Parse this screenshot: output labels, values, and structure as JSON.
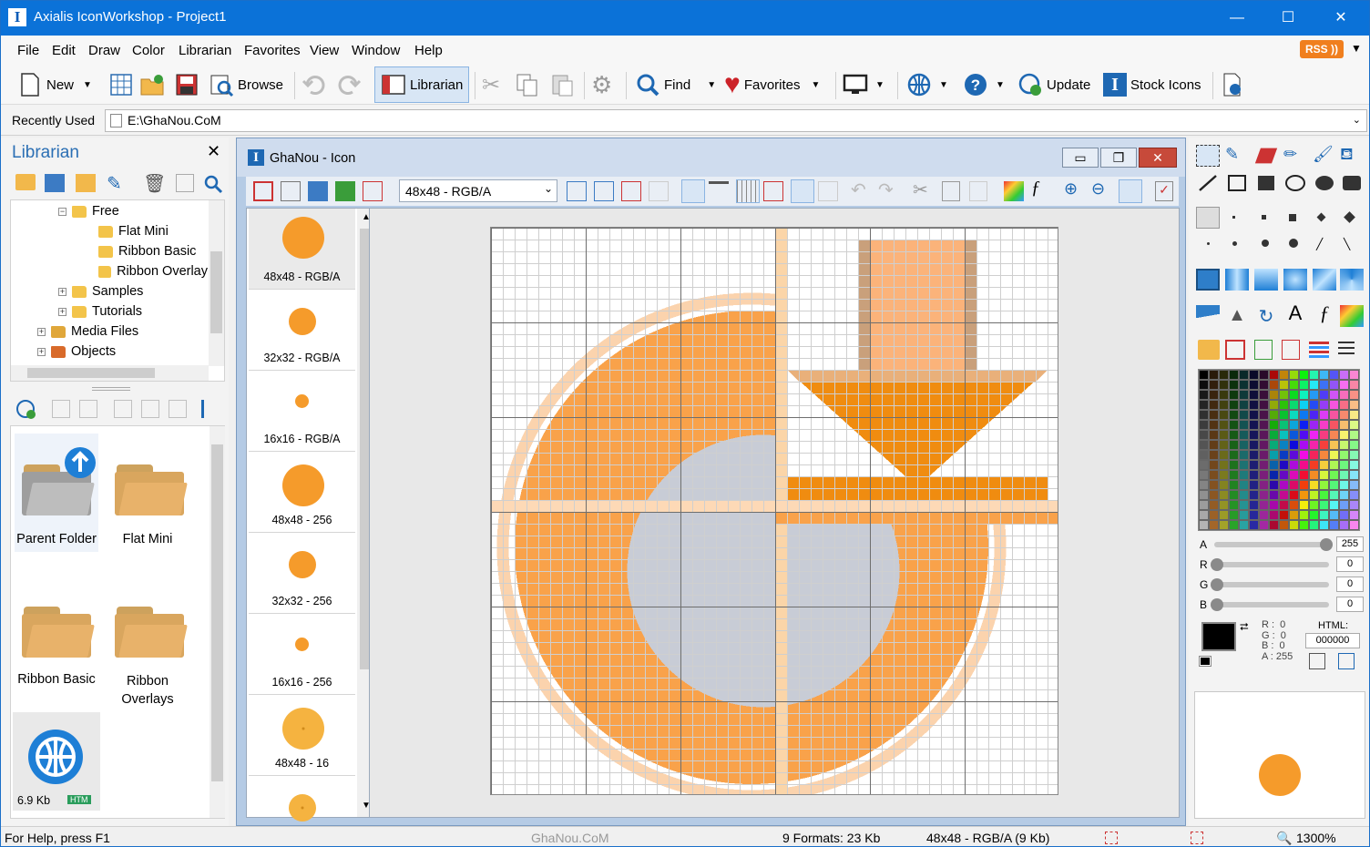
{
  "window": {
    "title": "Axialis IconWorkshop - Project1",
    "minimize": "—",
    "maximize": "☐",
    "close": "✕"
  },
  "menu": [
    "File",
    "Edit",
    "Draw",
    "Color",
    "Librarian",
    "Favorites",
    "View",
    "Window",
    "Help"
  ],
  "rss_label": "RSS",
  "toolbar": {
    "new": "New",
    "browse": "Browse",
    "librarian": "Librarian",
    "find": "Find",
    "favorites": "Favorites",
    "update": "Update",
    "stock_icons": "Stock Icons"
  },
  "recent": {
    "label": "Recently Used",
    "path": "E:\\GhaNou.CoM"
  },
  "librarian": {
    "title": "Librarian",
    "tree": [
      {
        "label": "Free",
        "expanded": true
      },
      {
        "label": "Flat Mini"
      },
      {
        "label": "Ribbon Basic"
      },
      {
        "label": "Ribbon Overlay"
      },
      {
        "label": "Samples"
      },
      {
        "label": "Tutorials"
      },
      {
        "label": "Media Files"
      },
      {
        "label": "Objects"
      }
    ],
    "thumbs": [
      {
        "label": "Parent Folder"
      },
      {
        "label": "Flat Mini"
      },
      {
        "label": "Ribbon Basic"
      },
      {
        "label": "Ribbon Overlays"
      }
    ],
    "file": {
      "size": "6.9 Kb",
      "badge": "HTM"
    }
  },
  "document": {
    "title": "GhaNou - Icon",
    "format_select": "48x48 - RGB/A",
    "formats": [
      {
        "label": "48x48 - RGB/A",
        "size": 48
      },
      {
        "label": "32x32 - RGB/A",
        "size": 32
      },
      {
        "label": "16x16 - RGB/A",
        "size": 16
      },
      {
        "label": "48x48 - 256",
        "size": 48
      },
      {
        "label": "32x32 - 256",
        "size": 32
      },
      {
        "label": "16x16 - 256",
        "size": 16
      },
      {
        "label": "48x48 - 16",
        "size": 48
      }
    ]
  },
  "color": {
    "a_label": "A",
    "r_label": "R",
    "g_label": "G",
    "b_label": "B",
    "a": "255",
    "r": "0",
    "g": "0",
    "b": "0",
    "rgba_text": "R :  0\nG :  0\nB :  0\nA : 255",
    "html_label": "HTML:",
    "html_value": "000000",
    "accent": "#0b72d8",
    "icon_orange": "#f59b2b"
  },
  "watermark": "GhaNou.CoM",
  "status": {
    "help": "For Help, press F1",
    "formats": "9 Formats: 23 Kb",
    "current": "48x48 - RGB/A (9 Kb)",
    "zoom": "1300%"
  }
}
